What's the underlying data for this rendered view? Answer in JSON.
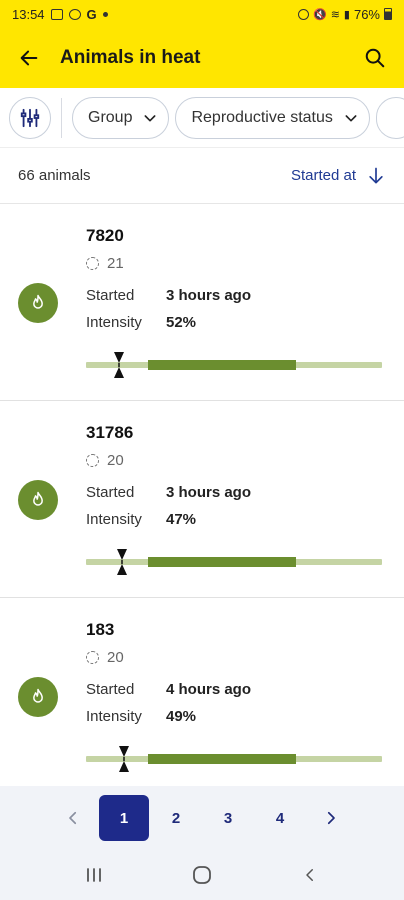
{
  "status_bar": {
    "time": "13:54",
    "g": "G",
    "battery": "76%"
  },
  "app_bar": {
    "title": "Animals in heat"
  },
  "filters": {
    "chips": [
      "Group",
      "Reproductive status"
    ]
  },
  "summary": {
    "count": "66 animals",
    "sort_label": "Started at"
  },
  "labels": {
    "started": "Started",
    "intensity": "Intensity"
  },
  "animals": [
    {
      "id": "7820",
      "lactation": "21",
      "started": "3 hours ago",
      "intensity": "52%",
      "progress_start": 0.21,
      "progress_end": 0.71,
      "marker": 0.11
    },
    {
      "id": "31786",
      "lactation": "20",
      "started": "3 hours ago",
      "intensity": "47%",
      "progress_start": 0.21,
      "progress_end": 0.71,
      "marker": 0.12
    },
    {
      "id": "183",
      "lactation": "20",
      "started": "4 hours ago",
      "intensity": "49%",
      "progress_start": 0.21,
      "progress_end": 0.71,
      "marker": 0.13
    }
  ],
  "pagination": {
    "pages": [
      "1",
      "2",
      "3",
      "4"
    ],
    "active": "1"
  },
  "colors": {
    "brand_yellow": "#ffe600",
    "heat_green": "#6b8e2f",
    "track_green": "#c5d4a4",
    "accent_blue": "#1e2a8a"
  },
  "icons": {
    "back": "arrow-left-icon",
    "search": "search-icon",
    "filter": "sliders-icon",
    "sort": "arrow-down-icon",
    "heat": "flame-icon"
  }
}
